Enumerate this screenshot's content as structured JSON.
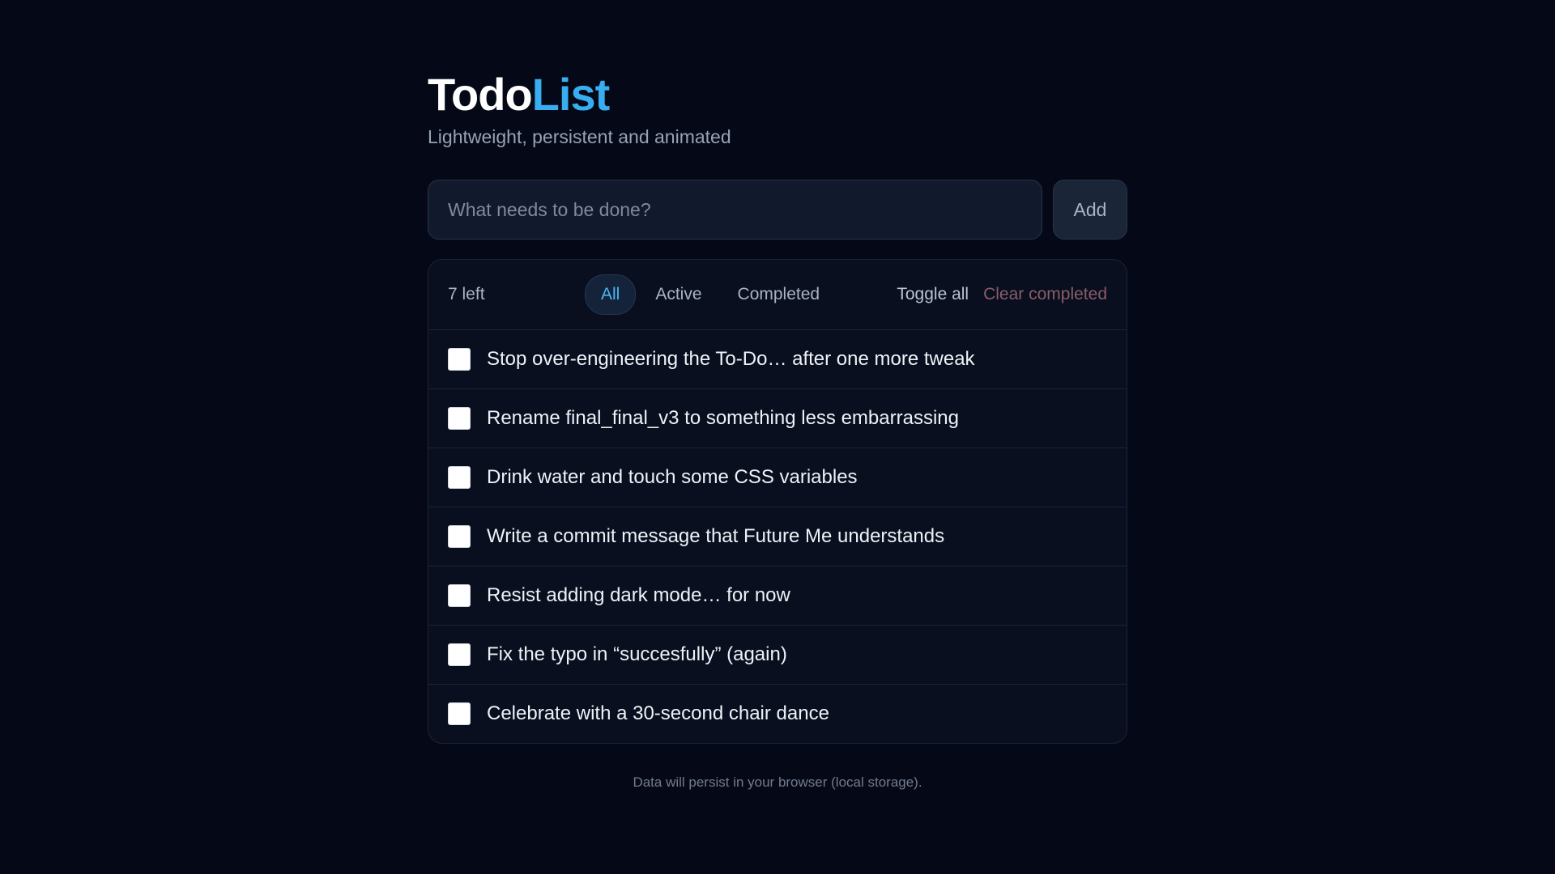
{
  "header": {
    "title_part1": "Todo",
    "title_part2": "List",
    "subtitle": "Lightweight, persistent and animated"
  },
  "add_form": {
    "placeholder": "What needs to be done?",
    "value": "",
    "add_label": "Add"
  },
  "toolbar": {
    "count_text": "7 left",
    "filters": [
      {
        "label": "All",
        "active": true
      },
      {
        "label": "Active",
        "active": false
      },
      {
        "label": "Completed",
        "active": false
      }
    ],
    "toggle_all_label": "Toggle all",
    "clear_completed_label": "Clear completed"
  },
  "todos": [
    {
      "text": "Stop over-engineering the To-Do… after one more tweak",
      "completed": false
    },
    {
      "text": "Rename final_final_v3 to something less embarrassing",
      "completed": false
    },
    {
      "text": "Drink water and touch some CSS variables",
      "completed": false
    },
    {
      "text": "Write a commit message that Future Me understands",
      "completed": false
    },
    {
      "text": "Resist adding dark mode… for now",
      "completed": false
    },
    {
      "text": "Fix the typo in “succesfully” (again)",
      "completed": false
    },
    {
      "text": "Celebrate with a 30-second chair dance",
      "completed": false
    }
  ],
  "footer": {
    "note": "Data will persist in your browser (local storage)."
  },
  "colors": {
    "background": "#050816",
    "accent": "#38aef0",
    "clear_completed": "#8a5c6a"
  }
}
